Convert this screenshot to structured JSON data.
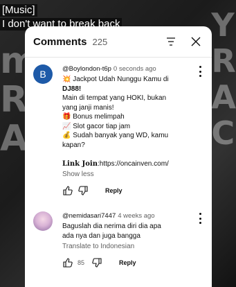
{
  "video": {
    "caption_line1": "[Music]",
    "caption_line2": "I don't want to break back"
  },
  "panel": {
    "title": "Comments",
    "count": "225"
  },
  "comments": [
    {
      "avatar_letter": "B",
      "handle": "@Boylondon-t6p",
      "time": "0 seconds ago",
      "lines": [
        "💥 Jackpot Udah Nunggu Kamu di",
        "DJ88!",
        "Main di tempat yang HOKI, bukan",
        "yang janji manis!",
        "🎁 Bonus melimpah",
        "📈 Slot gacor tiap jam",
        "💰 Sudah banyak yang WD, kamu",
        "kapan?",
        "",
        "Link Join:https://oncainven.com/"
      ],
      "link_label": "Link Join",
      "link_url": ":https://oncainven.com/",
      "more_label": "Show less",
      "reply_label": "Reply"
    },
    {
      "handle": "@nemidasari7447",
      "time": "4 weeks ago",
      "lines": [
        "Baguslah dia nerima diri dia apa",
        "ada nya dan juga bangga"
      ],
      "translate_label": "Translate to Indonesian",
      "likes": "85",
      "reply_label": "Reply"
    }
  ]
}
